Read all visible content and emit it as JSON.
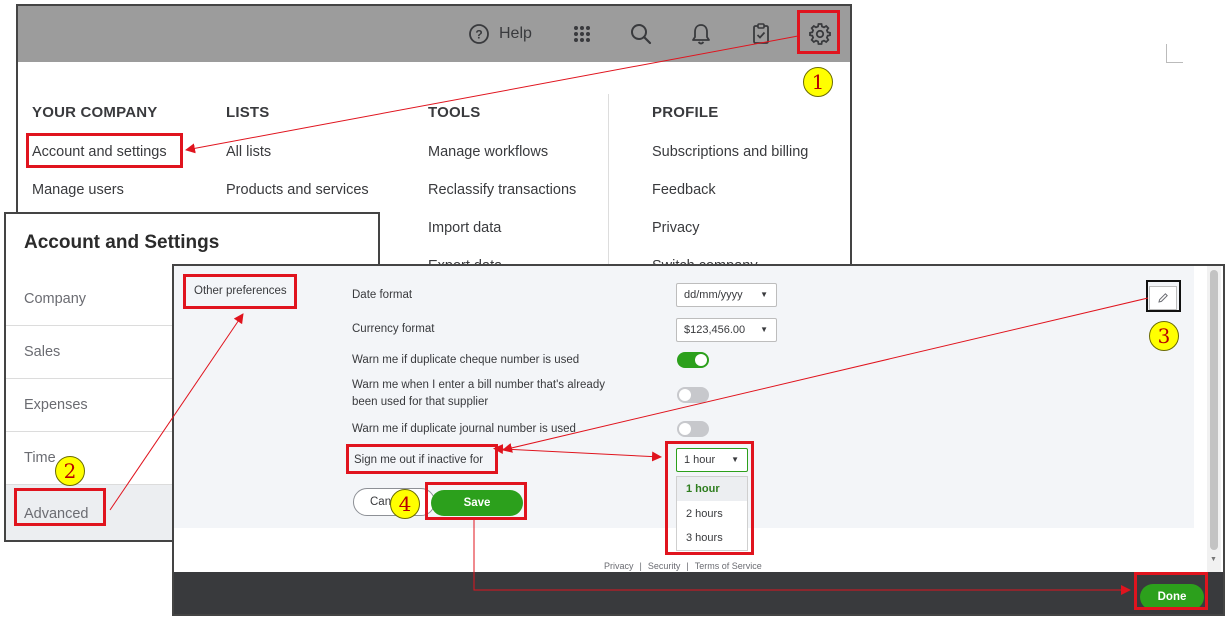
{
  "topbar": {
    "help_label": "Help",
    "icons": [
      "help-icon",
      "apps-grid-icon",
      "search-icon",
      "bell-icon",
      "clipboard-check-icon",
      "gear-icon"
    ]
  },
  "menu": {
    "columns": [
      {
        "header": "YOUR COMPANY",
        "items": [
          "Account and settings",
          "Manage users"
        ]
      },
      {
        "header": "LISTS",
        "items": [
          "All lists",
          "Products and services"
        ]
      },
      {
        "header": "TOOLS",
        "items": [
          "Manage workflows",
          "Reclassify transactions",
          "Import data",
          "Export data"
        ]
      },
      {
        "header": "PROFILE",
        "items": [
          "Subscriptions and billing",
          "Feedback",
          "Privacy",
          "Switch company"
        ]
      }
    ]
  },
  "nav": {
    "title": "Account and Settings",
    "items": [
      "Company",
      "Sales",
      "Expenses",
      "Time",
      "Advanced"
    ],
    "selected": "Advanced"
  },
  "advanced": {
    "section_label": "Other preferences",
    "date_format_label": "Date format",
    "date_format_value": "dd/mm/yyyy",
    "currency_format_label": "Currency format",
    "currency_format_value": "$123,456.00",
    "dup_cheque_label": "Warn me if duplicate cheque number is used",
    "dup_cheque_on": true,
    "dup_bill_label_1": "Warn me when I enter a bill number that's already",
    "dup_bill_label_2": "been used for that supplier",
    "dup_bill_on": false,
    "dup_journal_label": "Warn me if duplicate journal number is used",
    "dup_journal_on": false,
    "signout_label": "Sign me out if inactive for",
    "signout_value": "1 hour",
    "signout_options": [
      "1 hour",
      "2 hours",
      "3 hours"
    ],
    "cancel_label": "Cancel",
    "cancel_visible": "Can",
    "save_label": "Save",
    "footer_links": [
      "Privacy",
      "Security",
      "Terms of Service"
    ],
    "footer_sep": "|",
    "done_label": "Done"
  },
  "annotations": {
    "steps": [
      "1",
      "2",
      "3",
      "4"
    ]
  },
  "colors": {
    "topbar_bg": "#9c9c9c",
    "accent_green": "#2ca01c",
    "annotation_red": "#e0141e",
    "step_yellow": "#ffff00",
    "footer_dark": "#393a3d"
  }
}
